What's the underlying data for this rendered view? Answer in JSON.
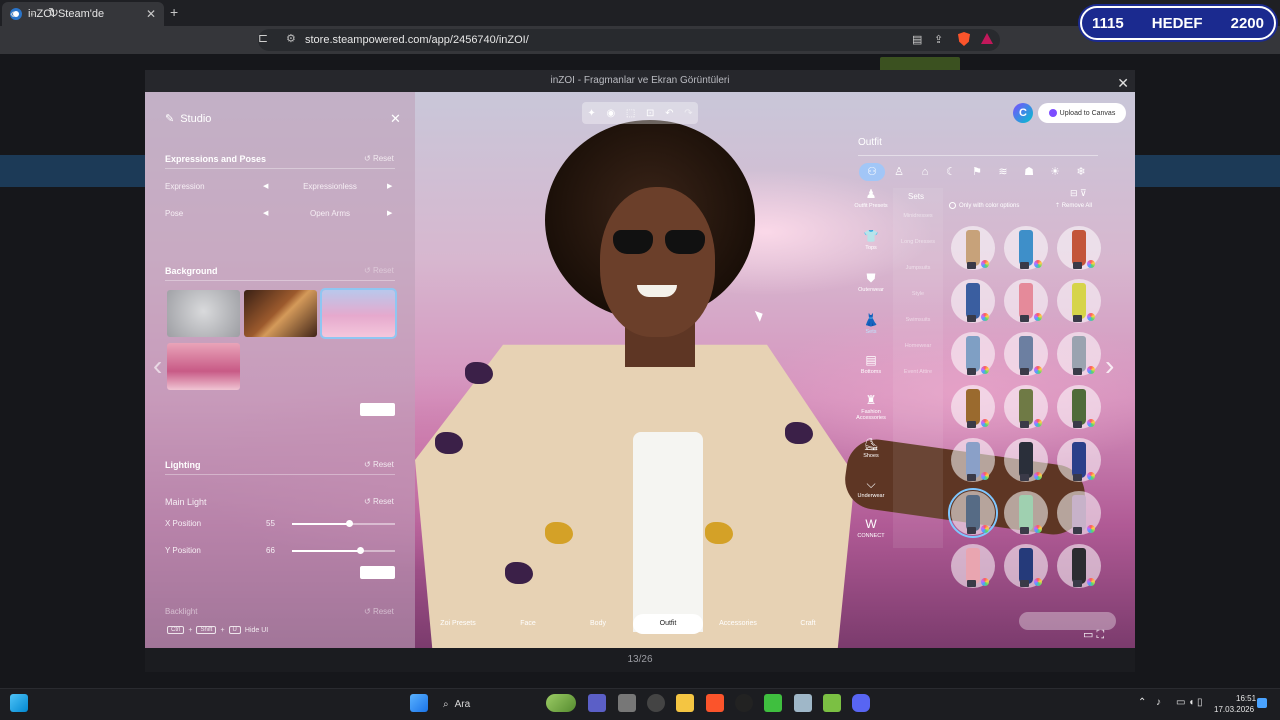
{
  "browser": {
    "tab_title": "inZOI Steam'de",
    "tab_close": "✕",
    "new_tab": "+",
    "url": "store.steampowered.com/app/2456740/inZOI/"
  },
  "score_widget": {
    "left_value": "1115",
    "label": "HEDEF",
    "right_value": "2200",
    "bg_color": "#1b2a8f"
  },
  "modal": {
    "title": "inZOI - Fragmanlar ve Ekran Görüntüleri",
    "close": "✕",
    "counter": "13/26"
  },
  "studio": {
    "title": "Studio",
    "close": "✕",
    "expressions": {
      "title": "Expressions and Poses",
      "reset": "Reset",
      "expression_label": "Expression",
      "expression_value": "Expressionless",
      "pose_label": "Pose",
      "pose_value": "Open Arms"
    },
    "background": {
      "title": "Background",
      "reset": "Reset"
    },
    "lighting": {
      "title": "Lighting",
      "reset": "Reset",
      "main_light": "Main Light",
      "main_reset": "Reset",
      "x_label": "X Position",
      "x_value": "55",
      "x_level": 0.55,
      "y_label": "Y Position",
      "y_value": "66",
      "y_level": 0.66,
      "backlight": "Backlight",
      "backlight_reset": "Reset"
    },
    "hotkeys": {
      "key1": "Ctrl",
      "key2": "Shift",
      "key3": "U",
      "label": "Hide UI"
    }
  },
  "upload": {
    "canva_letter": "C",
    "label": "Upload to Canvas"
  },
  "outfit": {
    "title": "Outfit",
    "side_nav": [
      "Outfit Presets",
      "Tops",
      "Outerwear",
      "Sets",
      "Bottoms",
      "Fashion Accessories",
      "Shoes",
      "Underwear",
      "CONNECT"
    ],
    "sub_title": "Sets",
    "sub_items": [
      "Minidresses",
      "Long Dresses",
      "Jumpsuits",
      "Style",
      "Swimsuits",
      "Homewear",
      "Event Attire"
    ],
    "color_option": "Only with color options",
    "remove_all": "Remove All"
  },
  "bottom_tabs": [
    "Zoi Presets",
    "Face",
    "Body",
    "Outfit",
    "Accessories",
    "Craft"
  ],
  "bottom_active": "Outfit",
  "taskbar": {
    "search": "Ara",
    "time": "16:51",
    "date": "17.03.2026"
  }
}
